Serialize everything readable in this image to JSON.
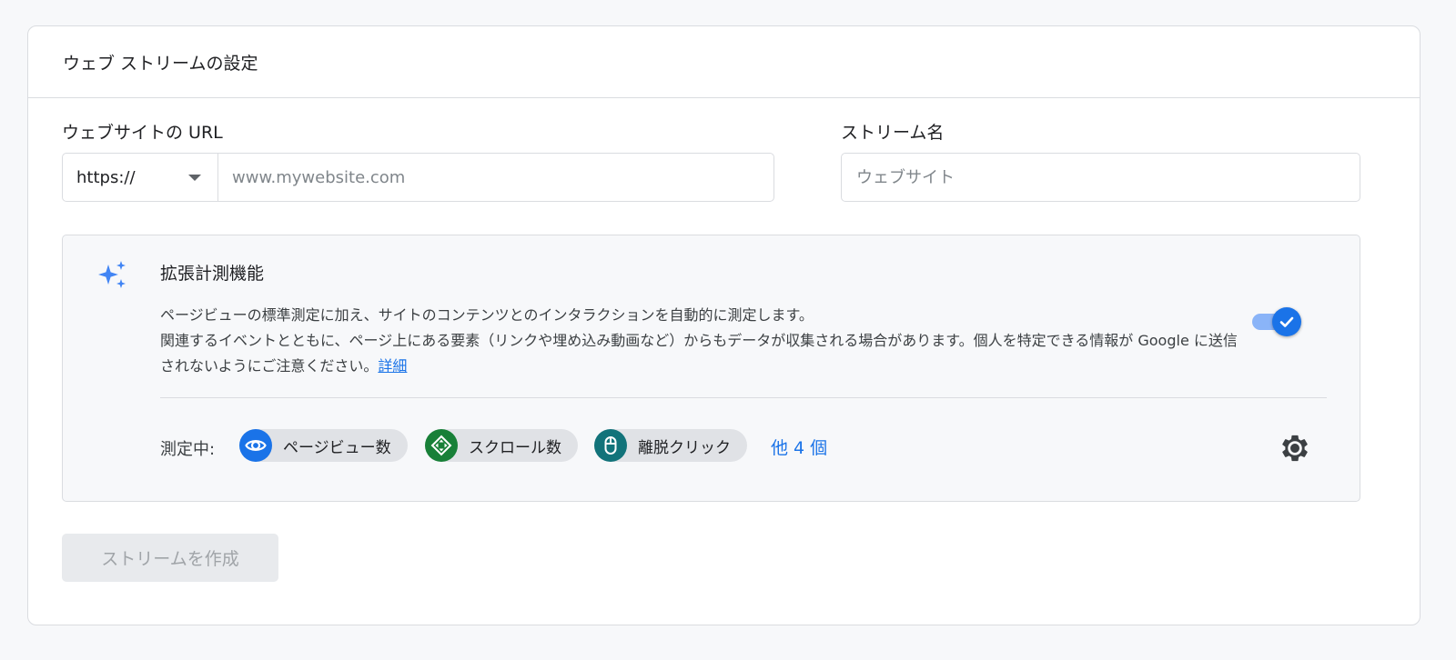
{
  "header": {
    "title": "ウェブ ストリームの設定"
  },
  "url_field": {
    "label": "ウェブサイトの URL",
    "protocol": "https://",
    "placeholder": "www.mywebsite.com"
  },
  "stream_name_field": {
    "label": "ストリーム名",
    "placeholder": "ウェブサイト"
  },
  "enhanced_measurement": {
    "title": "拡張計測機能",
    "description_line1": "ページビューの標準測定に加え、サイトのコンテンツとのインタラクションを自動的に測定します。",
    "description_line2": "関連するイベントとともに、ページ上にある要素（リンクや埋め込み動画など）からもデータが収集される場合があります。個人を特定できる情報が Google に送信されないようにご注意ください。",
    "learn_more": "詳細",
    "enabled": true,
    "measuring_label": "測定中:",
    "chips": [
      {
        "label": "ページビュー数",
        "icon": "eye-icon",
        "color": "#1a73e8"
      },
      {
        "label": "スクロール数",
        "icon": "scroll-icon",
        "color": "#188038"
      },
      {
        "label": "離脱クリック",
        "icon": "mouse-icon",
        "color": "#12737a"
      }
    ],
    "more_link": "他 4 個",
    "settings_icon": "gear-icon"
  },
  "actions": {
    "create_label": "ストリームを作成"
  },
  "colors": {
    "accent": "#1a73e8",
    "toggle_track": "#8ab4f8",
    "border": "#dadce0",
    "panel_bg": "#f7f8fa"
  }
}
